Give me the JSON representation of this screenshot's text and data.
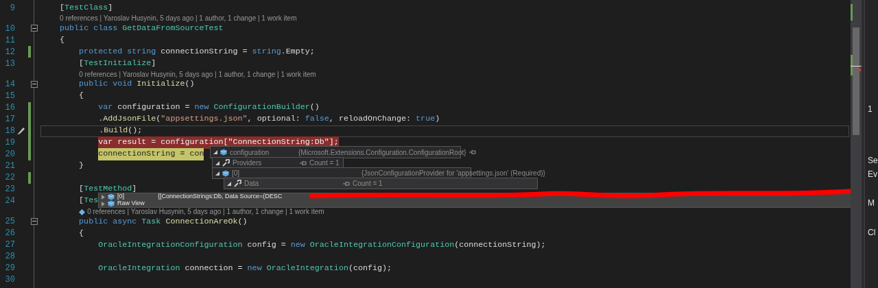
{
  "editor": {
    "lines": [
      {
        "number": "9",
        "change": false,
        "fold": false,
        "current": false,
        "segments": [
          {
            "kind": "plain",
            "text": "    ["
          },
          {
            "kind": "type",
            "text": "TestClass"
          },
          {
            "kind": "plain",
            "text": "]"
          }
        ],
        "codelens": {
          "text": "0 references | Yaroslav Husynin, 5 days ago | 1 author, 1 change | 1 work item",
          "icon": false
        }
      },
      {
        "number": "10",
        "change": false,
        "fold": true,
        "current": false,
        "segments": [
          {
            "kind": "keyword",
            "text": "    public class "
          },
          {
            "kind": "type",
            "text": "GetDataFromSourceTest"
          }
        ]
      },
      {
        "number": "11",
        "change": false,
        "fold": false,
        "current": false,
        "segments": [
          {
            "kind": "plain",
            "text": "    {"
          }
        ]
      },
      {
        "number": "12",
        "change": true,
        "fold": false,
        "current": false,
        "segments": [
          {
            "kind": "keyword",
            "text": "        protected string "
          },
          {
            "kind": "plain",
            "text": "connectionString = "
          },
          {
            "kind": "keyword",
            "text": "string"
          },
          {
            "kind": "plain",
            "text": ".Empty;"
          }
        ]
      },
      {
        "number": "13",
        "change": false,
        "fold": false,
        "current": false,
        "segments": [
          {
            "kind": "plain",
            "text": "        ["
          },
          {
            "kind": "type",
            "text": "TestInitialize"
          },
          {
            "kind": "plain",
            "text": "]"
          }
        ],
        "codelens": {
          "text": "0 references | Yaroslav Husynin, 5 days ago | 1 author, 1 change | 1 work item",
          "icon": false
        }
      },
      {
        "number": "14",
        "change": false,
        "fold": true,
        "current": false,
        "segments": [
          {
            "kind": "keyword",
            "text": "        public void "
          },
          {
            "kind": "method",
            "text": "Initialize"
          },
          {
            "kind": "plain",
            "text": "()"
          }
        ]
      },
      {
        "number": "15",
        "change": false,
        "fold": false,
        "current": false,
        "segments": [
          {
            "kind": "plain",
            "text": "        {"
          }
        ]
      },
      {
        "number": "16",
        "change": true,
        "fold": false,
        "current": false,
        "segments": [
          {
            "kind": "keyword",
            "text": "            var "
          },
          {
            "kind": "plain",
            "text": "configuration = "
          },
          {
            "kind": "keyword",
            "text": "new "
          },
          {
            "kind": "type",
            "text": "ConfigurationBuilder"
          },
          {
            "kind": "plain",
            "text": "()"
          }
        ]
      },
      {
        "number": "17",
        "change": true,
        "fold": false,
        "current": false,
        "segments": [
          {
            "kind": "plain",
            "text": "            ."
          },
          {
            "kind": "method",
            "text": "AddJsonFile"
          },
          {
            "kind": "plain",
            "text": "("
          },
          {
            "kind": "string",
            "text": "\"appsettings.json\""
          },
          {
            "kind": "plain",
            "text": ", optional: "
          },
          {
            "kind": "keyword",
            "text": "false"
          },
          {
            "kind": "plain",
            "text": ", reloadOnChange: "
          },
          {
            "kind": "keyword",
            "text": "true"
          },
          {
            "kind": "plain",
            "text": ")"
          }
        ]
      },
      {
        "number": "18",
        "change": true,
        "fold": false,
        "current": true,
        "segments": [
          {
            "kind": "plain",
            "text": "            ."
          },
          {
            "kind": "method",
            "text": "Build"
          },
          {
            "kind": "plain",
            "text": "();"
          }
        ]
      },
      {
        "number": "19",
        "change": true,
        "fold": false,
        "current": false,
        "kind": "breakpoint",
        "segments": [
          {
            "kind": "plain",
            "text": "            var result = configuration[\"ConnectionString:Db\"];"
          }
        ]
      },
      {
        "number": "20",
        "change": true,
        "fold": false,
        "current": false,
        "kind": "step",
        "segments": [
          {
            "kind": "plain",
            "text": "            connectionString = con"
          }
        ]
      },
      {
        "number": "21",
        "change": false,
        "fold": false,
        "current": false,
        "segments": [
          {
            "kind": "plain",
            "text": "        }"
          }
        ]
      },
      {
        "number": "22",
        "change": true,
        "fold": false,
        "current": false
      },
      {
        "number": "23",
        "change": false,
        "fold": false,
        "current": false,
        "segments": [
          {
            "kind": "plain",
            "text": "        ["
          },
          {
            "kind": "type",
            "text": "TestMethod"
          },
          {
            "kind": "plain",
            "text": "]"
          }
        ]
      },
      {
        "number": "24",
        "change": false,
        "fold": false,
        "current": false,
        "segments": [
          {
            "kind": "plain",
            "text": "        ["
          },
          {
            "kind": "type",
            "text": "Tes"
          }
        ],
        "codelens": {
          "text": "0 references | Yaroslav Husynin, 5 days ago | 1 author, 1 change | 1 work item",
          "icon": true
        }
      },
      {
        "number": "25",
        "change": false,
        "fold": true,
        "current": false,
        "segments": [
          {
            "kind": "keyword",
            "text": "        public async "
          },
          {
            "kind": "type",
            "text": "Task "
          },
          {
            "kind": "method",
            "text": "ConnectionAreOk"
          },
          {
            "kind": "plain",
            "text": "()"
          }
        ]
      },
      {
        "number": "26",
        "change": false,
        "fold": false,
        "current": false,
        "segments": [
          {
            "kind": "plain",
            "text": "        {"
          }
        ]
      },
      {
        "number": "27",
        "change": false,
        "fold": false,
        "current": false,
        "segments": [
          {
            "kind": "type",
            "text": "            OracleIntegrationConfiguration "
          },
          {
            "kind": "plain",
            "text": "config = "
          },
          {
            "kind": "keyword",
            "text": "new "
          },
          {
            "kind": "type",
            "text": "OracleIntegrationConfiguration"
          },
          {
            "kind": "plain",
            "text": "(connectionString);"
          }
        ]
      },
      {
        "number": "28",
        "change": false,
        "fold": false,
        "current": false
      },
      {
        "number": "29",
        "change": false,
        "fold": false,
        "current": false,
        "segments": [
          {
            "kind": "type",
            "text": "            OracleIntegration "
          },
          {
            "kind": "plain",
            "text": "connection = "
          },
          {
            "kind": "keyword",
            "text": "new "
          },
          {
            "kind": "type",
            "text": "OracleIntegration"
          },
          {
            "kind": "plain",
            "text": "(config);"
          }
        ]
      },
      {
        "number": "30",
        "change": false,
        "fold": false,
        "current": false
      }
    ]
  },
  "datatip": {
    "rows": [
      {
        "name": "configuration",
        "kind": "object",
        "expanded": true,
        "value": "{Microsoft.Extensions.Configuration.ConfigurationRoot}",
        "children": [
          {
            "name": "Providers",
            "kind": "property",
            "expanded": true,
            "value": "Count = 1",
            "children": [
              {
                "name": "[0]",
                "kind": "object",
                "expanded": true,
                "value": "{JsonConfigurationProvider for 'appsettings.json' (Required)}",
                "children": [
                  {
                    "name": "Data",
                    "kind": "property",
                    "expanded": true,
                    "value": "Count = 1",
                    "children": [
                      {
                        "name": "[0]",
                        "kind": "object",
                        "expanded": false,
                        "value": "{[ConnectionStrings:Db, Data Source=(DESC"
                      },
                      {
                        "name": "Raw View",
                        "kind": "object",
                        "expanded": false
                      }
                    ]
                  }
                ]
              }
            ]
          }
        ]
      }
    ]
  },
  "side_panel": {
    "labels": [
      "1",
      "Se",
      "Ev",
      "M",
      "Cl"
    ]
  }
}
